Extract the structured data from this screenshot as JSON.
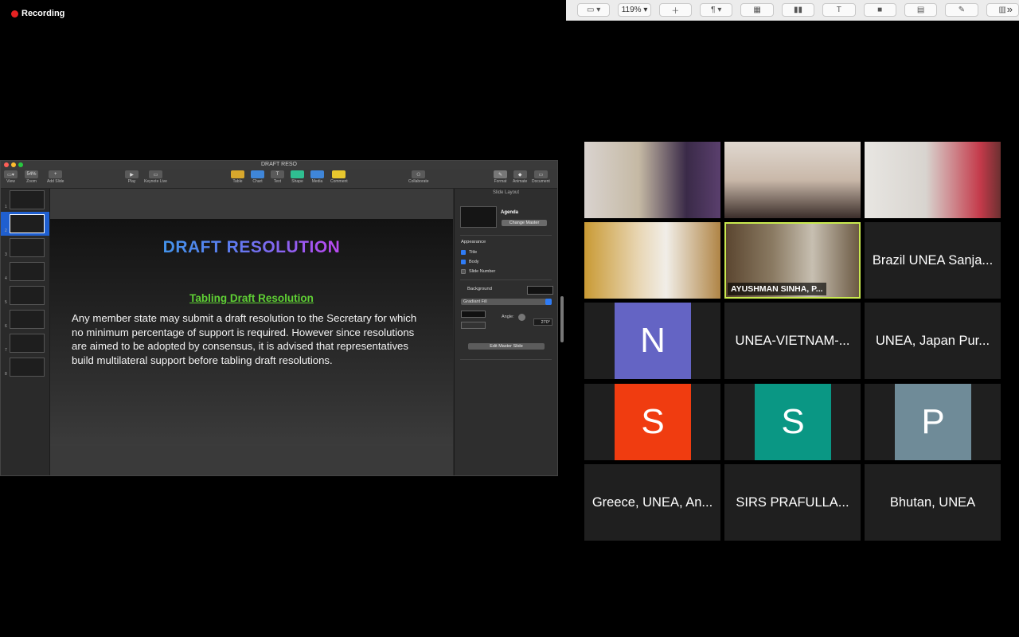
{
  "recording": {
    "label": "Recording"
  },
  "top_toolbar": {
    "zoom": "119%",
    "more": "»"
  },
  "keynote": {
    "window_title": "DRAFT RESO",
    "toolbar": {
      "view": "View",
      "zoom": "Zoom",
      "zoom_value": "54%",
      "add_slide": "Add Slide",
      "play": "Play",
      "keynote_live": "Keynote Live",
      "table": "Table",
      "chart": "Chart",
      "text": "Text",
      "shape": "Shape",
      "media": "Media",
      "comment": "Comment",
      "collaborate": "Collaborate",
      "format": "Format",
      "animate": "Animate",
      "document": "Document"
    },
    "slides": [
      "1",
      "2",
      "3",
      "4",
      "5",
      "6",
      "7",
      "8"
    ],
    "current_slide": {
      "title": "DRAFT RESOLUTION",
      "subtitle": "Tabling Draft Resolution",
      "body": "Any member state may submit a draft resolution to the Secretary for which no minimum percentage of support is required. However since resolutions are aimed to be adopted by consensus, it is advised that representatives build multilateral support before tabling draft resolutions."
    },
    "inspector": {
      "heading": "Slide Layout",
      "layout_name": "Agenda",
      "change_master": "Change Master",
      "appearance": "Appearance",
      "title_cb": "Title",
      "body_cb": "Body",
      "slide_number_cb": "Slide Number",
      "background": "Background",
      "fill_type": "Gradiant Fill",
      "angle_label": "Angle:",
      "angle_value": "270°",
      "edit_master": "Edit Master Slide"
    }
  },
  "gallery": {
    "names": {
      "ayushman": "AYUSHMAN SINHA, P...",
      "brazil": "Brazil UNEA Sanja...",
      "vietnam": "UNEA-VIETNAM-...",
      "japan": "UNEA, Japan Pur...",
      "greece": "Greece, UNEA, An...",
      "sirs": "SIRS PRAFULLA...",
      "bhutan": "Bhutan, UNEA"
    },
    "avatars": {
      "n": {
        "letter": "N",
        "color": "#6464c4"
      },
      "s1": {
        "letter": "S",
        "color": "#f03c10"
      },
      "s2": {
        "letter": "S",
        "color": "#0a9784"
      },
      "p": {
        "letter": "P",
        "color": "#6f8b98"
      }
    }
  }
}
